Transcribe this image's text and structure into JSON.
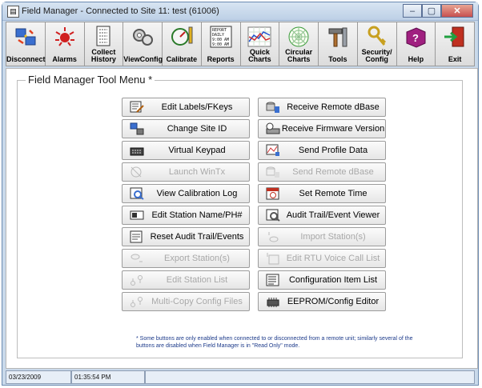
{
  "window": {
    "title": "Field Manager - Connected to Site 11: test (61006)",
    "controls": {
      "minimize": "–",
      "maximize": "▢",
      "close": "✕"
    }
  },
  "toolbar": [
    {
      "label": "Disconnect",
      "icon": "disconnect-icon",
      "enabled": true
    },
    {
      "label": "Alarms",
      "icon": "alarms-icon",
      "enabled": true
    },
    {
      "label": "Collect\nHistory",
      "icon": "collect-history-icon",
      "enabled": true
    },
    {
      "label": "ViewConfig",
      "icon": "view-config-icon",
      "enabled": true
    },
    {
      "label": "Calibrate",
      "icon": "calibrate-icon",
      "enabled": true
    },
    {
      "label": "Reports",
      "icon": "reports-icon",
      "enabled": true,
      "icon_text": "REPORT\nDAILY\n9:00 AM\n9:00 AM"
    },
    {
      "label": "Quick\nCharts",
      "icon": "quick-charts-icon",
      "enabled": true
    },
    {
      "label": "Circular\nCharts",
      "icon": "circular-charts-icon",
      "enabled": true
    },
    {
      "label": "Tools",
      "icon": "tools-icon",
      "enabled": true
    },
    {
      "label": "Security/\nConfig",
      "icon": "security-config-icon",
      "enabled": true
    },
    {
      "label": "Help",
      "icon": "help-icon",
      "enabled": true
    },
    {
      "label": "Exit",
      "icon": "exit-icon",
      "enabled": true
    }
  ],
  "tool_menu": {
    "title": "Field Manager Tool Menu *",
    "buttons": [
      {
        "label": "Edit Labels/FKeys",
        "icon": "edit-labels-icon",
        "enabled": true
      },
      {
        "label": "Receive Remote dBase",
        "icon": "receive-dbase-icon",
        "enabled": true
      },
      {
        "label": "Change Site ID",
        "icon": "change-site-id-icon",
        "enabled": true
      },
      {
        "label": "Receive Firmware Version",
        "icon": "firmware-icon",
        "enabled": true
      },
      {
        "label": "Virtual Keypad",
        "icon": "keypad-icon",
        "enabled": true
      },
      {
        "label": "Send Profile Data",
        "icon": "send-profile-icon",
        "enabled": true
      },
      {
        "label": "Launch WinTx",
        "icon": "wintx-icon",
        "enabled": false
      },
      {
        "label": "Send Remote dBase",
        "icon": "send-dbase-icon",
        "enabled": false
      },
      {
        "label": "View Calibration Log",
        "icon": "calibration-log-icon",
        "enabled": true
      },
      {
        "label": "Set Remote Time",
        "icon": "calendar-clock-icon",
        "enabled": true
      },
      {
        "label": "Edit Station Name/PH#",
        "icon": "station-name-icon",
        "enabled": true
      },
      {
        "label": "Audit Trail/Event Viewer",
        "icon": "audit-viewer-icon",
        "enabled": true
      },
      {
        "label": "Reset Audit Trail/Events",
        "icon": "audit-reset-icon",
        "enabled": true
      },
      {
        "label": "Import Station(s)",
        "icon": "import-icon",
        "enabled": false
      },
      {
        "label": "Export Station(s)",
        "icon": "export-icon",
        "enabled": false
      },
      {
        "label": "Edit RTU Voice Call List",
        "icon": "voice-call-icon",
        "enabled": false
      },
      {
        "label": "Edit Station List",
        "icon": "station-list-icon",
        "enabled": false
      },
      {
        "label": "Configuration Item List",
        "icon": "config-list-icon",
        "enabled": true
      },
      {
        "label": "Multi-Copy Config Files",
        "icon": "multi-copy-icon",
        "enabled": false
      },
      {
        "label": "EEPROM/Config Editor",
        "icon": "eeprom-icon",
        "enabled": true
      }
    ],
    "footnote": "* Some buttons are only enabled when connected to or disconnected from a remote unit; similarly several of the buttons are disabled when Field Manager is in \"Read Only\" mode."
  },
  "status": {
    "date": "03/23/2009",
    "time": "01:35:54 PM"
  },
  "colors": {
    "titlebar": "#c9d9ea",
    "footnote": "#1c3a8a",
    "disabled_text": "#a8a8a8",
    "close": "#c75050"
  }
}
